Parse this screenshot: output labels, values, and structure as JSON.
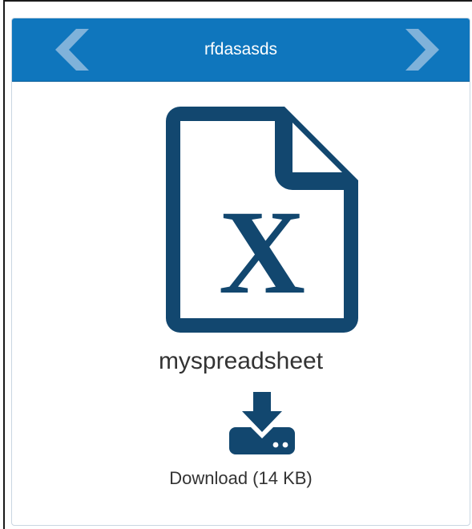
{
  "header": {
    "title": "rfdasasds",
    "prev_icon": "chevron-left-icon",
    "next_icon": "chevron-right-icon",
    "background_color": "#0f76bd"
  },
  "file": {
    "icon": "excel-file-icon",
    "icon_letter": "X",
    "icon_color": "#12476f",
    "name": "myspreadsheet"
  },
  "download": {
    "icon": "download-icon",
    "label": "Download (14 KB)"
  }
}
